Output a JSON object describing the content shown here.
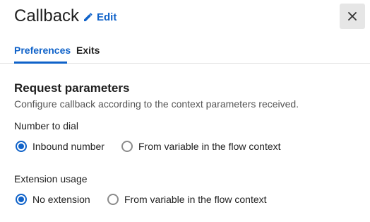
{
  "header": {
    "title": "Callback",
    "edit_label": "Edit"
  },
  "tabs": [
    {
      "label": "Preferences",
      "active": true
    },
    {
      "label": "Exits",
      "active": false
    }
  ],
  "section": {
    "title": "Request parameters",
    "description": "Configure callback according to the context parameters received."
  },
  "number_to_dial": {
    "label": "Number to dial",
    "options": [
      {
        "label": "Inbound number",
        "selected": true
      },
      {
        "label": "From variable in the flow context",
        "selected": false
      }
    ]
  },
  "extension_usage": {
    "label": "Extension usage",
    "options": [
      {
        "label": "No extension",
        "selected": true
      },
      {
        "label": "From variable in the flow context",
        "selected": false
      }
    ]
  },
  "colors": {
    "accent": "#0f62c9",
    "close_bg": "#e6e6e6"
  },
  "icons": {
    "edit": "pencil-icon",
    "close": "close-icon"
  }
}
